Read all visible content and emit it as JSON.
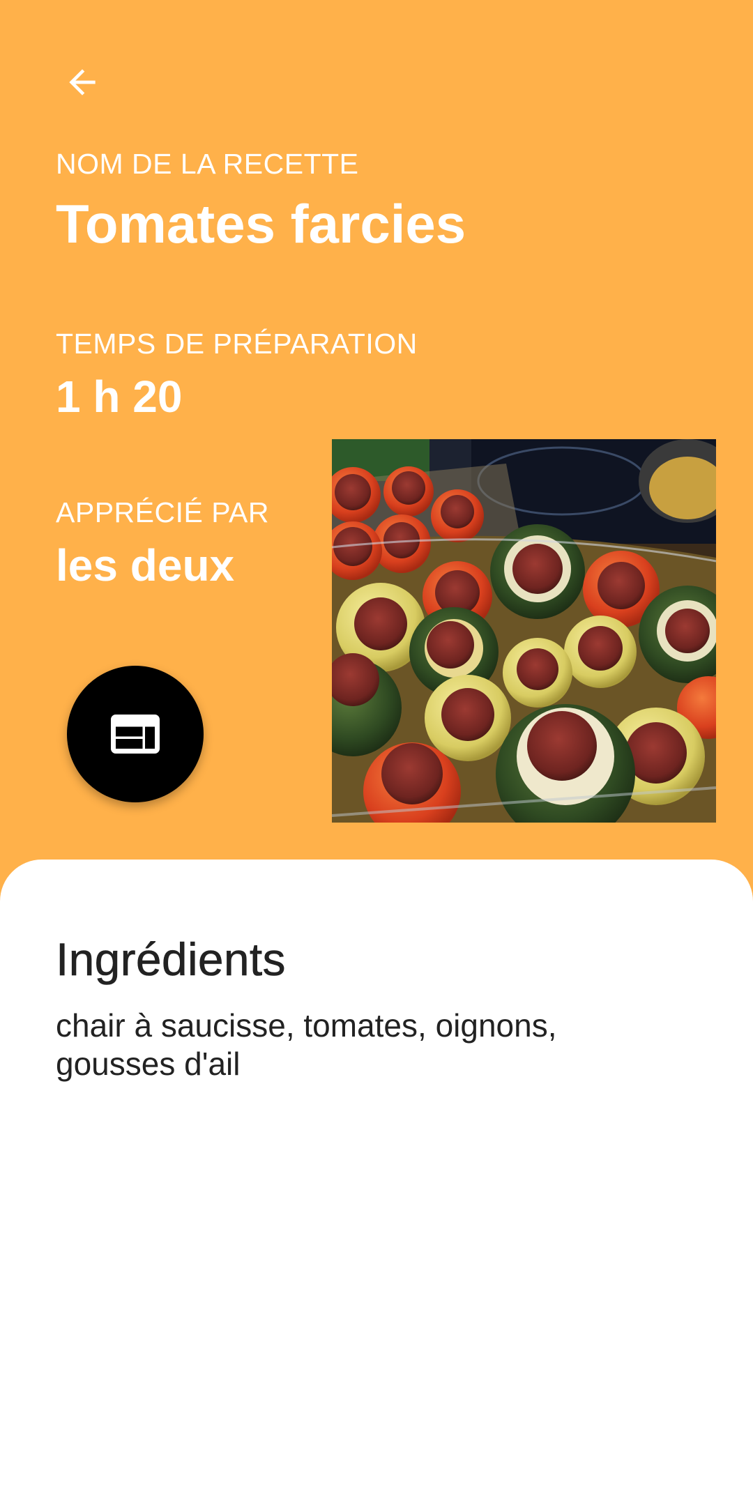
{
  "recipe": {
    "name_label": "NOM DE LA RECETTE",
    "name": "Tomates farcies",
    "time_label": "TEMPS DE PRÉPARATION",
    "time": "1 h 20",
    "liked_label": "APPRÉCIÉ PAR",
    "liked_by": "les deux"
  },
  "ingredients": {
    "title": "Ingrédients",
    "text": "chair à saucisse, tomates, oignons, gousses d'ail"
  },
  "icons": {
    "back": "arrow-back-icon",
    "fab": "web-layout-icon"
  },
  "colors": {
    "header_background": "#FFB14A",
    "sheet_background": "#FFFFFF",
    "text_dark": "#222222",
    "fab_background": "#000000"
  }
}
